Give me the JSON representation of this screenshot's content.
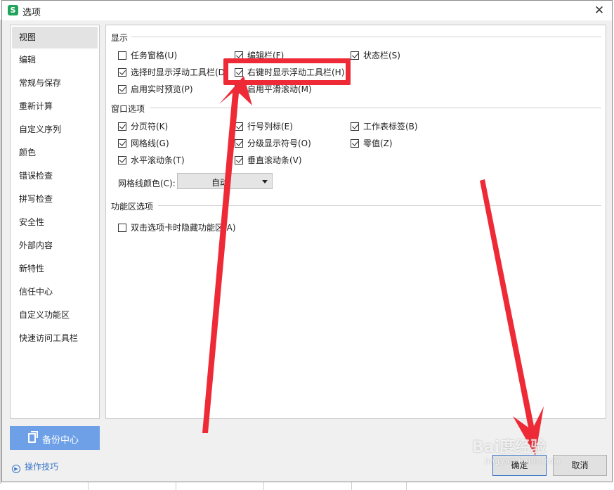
{
  "window": {
    "title": "选项",
    "app_icon_letter": "S"
  },
  "nav": {
    "items": [
      {
        "label": "视图",
        "active": true
      },
      {
        "label": "编辑"
      },
      {
        "label": "常规与保存"
      },
      {
        "label": "重新计算"
      },
      {
        "label": "自定义序列"
      },
      {
        "label": "颜色"
      },
      {
        "label": "错误检查"
      },
      {
        "label": "拼写检查"
      },
      {
        "label": "安全性"
      },
      {
        "label": "外部内容"
      },
      {
        "label": "新特性"
      },
      {
        "label": "信任中心"
      },
      {
        "label": "自定义功能区"
      },
      {
        "label": "快速访问工具栏"
      }
    ],
    "backup_label": "备份中心",
    "tips_label": "操作技巧"
  },
  "display": {
    "title": "显示",
    "options": [
      {
        "label": "任务窗格(U)",
        "checked": false
      },
      {
        "label": "编辑栏(F)",
        "checked": true
      },
      {
        "label": "状态栏(S)",
        "checked": true
      },
      {
        "label": "选择时显示浮动工具栏(D)",
        "checked": true
      },
      {
        "label": "右键时显示浮动工具栏(H)",
        "checked": true
      },
      {
        "label": "启用实时预览(P)",
        "checked": true
      },
      {
        "label": "启用平滑滚动(M)",
        "checked": true
      }
    ]
  },
  "window_options": {
    "title": "窗口选项",
    "options": [
      {
        "label": "分页符(K)",
        "checked": true
      },
      {
        "label": "行号列标(E)",
        "checked": true
      },
      {
        "label": "工作表标签(B)",
        "checked": true
      },
      {
        "label": "网格线(G)",
        "checked": true
      },
      {
        "label": "分级显示符号(O)",
        "checked": true
      },
      {
        "label": "零值(Z)",
        "checked": true
      },
      {
        "label": "水平滚动条(T)",
        "checked": true
      },
      {
        "label": "垂直滚动条(V)",
        "checked": true
      }
    ],
    "grid_color_label": "网格线颜色(C):",
    "grid_color_value": "自动"
  },
  "ribbon": {
    "title": "功能区选项",
    "options": [
      {
        "label": "双击选项卡时隐藏功能区(A)",
        "checked": false
      }
    ]
  },
  "buttons": {
    "ok": "确定",
    "cancel": "取消"
  },
  "annotation_color": "#ee2a36",
  "watermark": {
    "main": "Bai度经验",
    "sub": "jingyan.baidu.com"
  }
}
